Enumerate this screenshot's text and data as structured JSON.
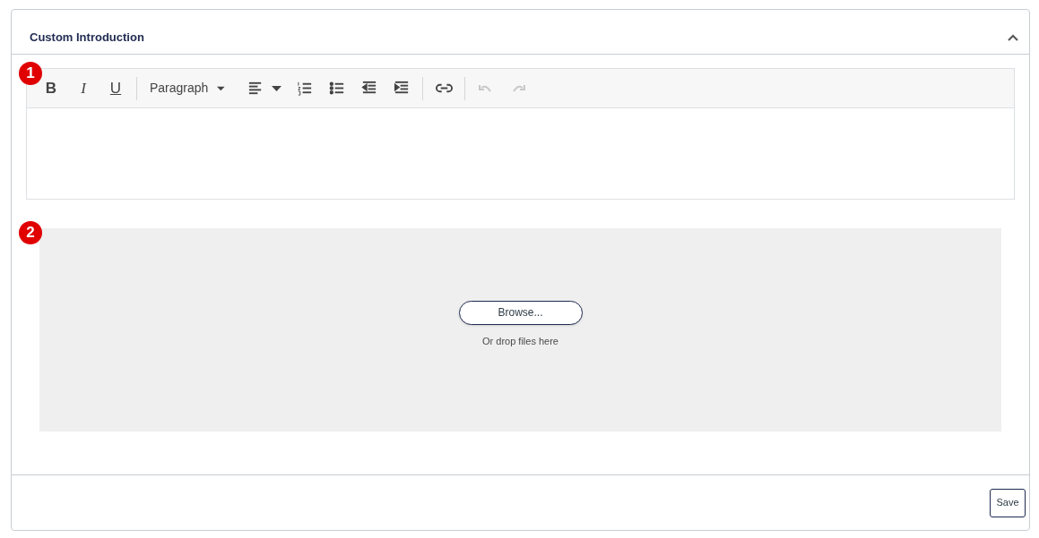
{
  "panel": {
    "title": "Custom Introduction",
    "expanded": true
  },
  "editor": {
    "marker": "1",
    "toolbar": [
      {
        "kind": "bold",
        "label": "B",
        "disabled": false
      },
      {
        "kind": "italic",
        "label": "I",
        "disabled": false
      },
      {
        "kind": "underline",
        "label": "U",
        "disabled": false
      },
      {
        "kind": "divider"
      },
      {
        "kind": "dropdown",
        "label": "Paragraph",
        "disabled": false
      },
      {
        "kind": "align",
        "disabled": false
      },
      {
        "kind": "numbered",
        "disabled": false
      },
      {
        "kind": "bullets",
        "disabled": false
      },
      {
        "kind": "outdent",
        "disabled": false
      },
      {
        "kind": "indent",
        "disabled": false
      },
      {
        "kind": "divider"
      },
      {
        "kind": "link",
        "disabled": false
      },
      {
        "kind": "divider"
      },
      {
        "kind": "undo",
        "disabled": true
      },
      {
        "kind": "redo",
        "disabled": true
      }
    ]
  },
  "upload": {
    "marker": "2",
    "button": "Browse...",
    "hint": "Or drop files here"
  },
  "footer": {
    "button": "Save"
  }
}
